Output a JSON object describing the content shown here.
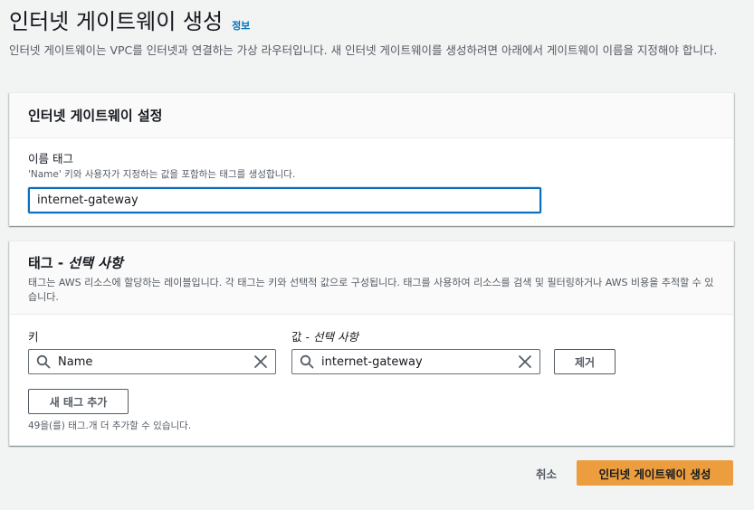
{
  "header": {
    "title": "인터넷 게이트웨이 생성",
    "info_link": "정보",
    "description": "인터넷 게이트웨이는 VPC를 인터넷과 연결하는 가상 라우터입니다. 새 인터넷 게이트웨이를 생성하려면 아래에서 게이트웨이 이름을 지정해야 합니다."
  },
  "settings": {
    "title": "인터넷 게이트웨이 설정",
    "name_label": "이름 태그",
    "name_description": "'Name' 키와 사용자가 지정하는 값을 포함하는 태그를 생성합니다.",
    "name_value": "internet-gateway"
  },
  "tags": {
    "title_prefix": "태그 - ",
    "title_optional": "선택 사항",
    "description": "태그는 AWS 리소스에 할당하는 레이블입니다. 각 태그는 키와 선택적 값으로 구성됩니다. 태그를 사용하여 리소스를 검색 및 필터링하거나 AWS 비용을 추적할 수 있습니다.",
    "key_label": "키",
    "value_label_prefix": "값 - ",
    "value_label_optional": "선택 사항",
    "rows": [
      {
        "key": "Name",
        "value": "internet-gateway"
      }
    ],
    "remove_label": "제거",
    "add_label": "새 태그 추가",
    "limit_text": "49을(를) 태그.개 더 추가할 수 있습니다."
  },
  "footer": {
    "cancel_label": "취소",
    "submit_label": "인터넷 게이트웨이 생성"
  },
  "icons": {
    "info": "info-link",
    "search": "search-icon",
    "clear": "clear-icon"
  },
  "colors": {
    "primary_button": "#ec9d3d",
    "link": "#0073bb",
    "focus_border": "#0a6ebd",
    "background": "#f2f3f3"
  }
}
